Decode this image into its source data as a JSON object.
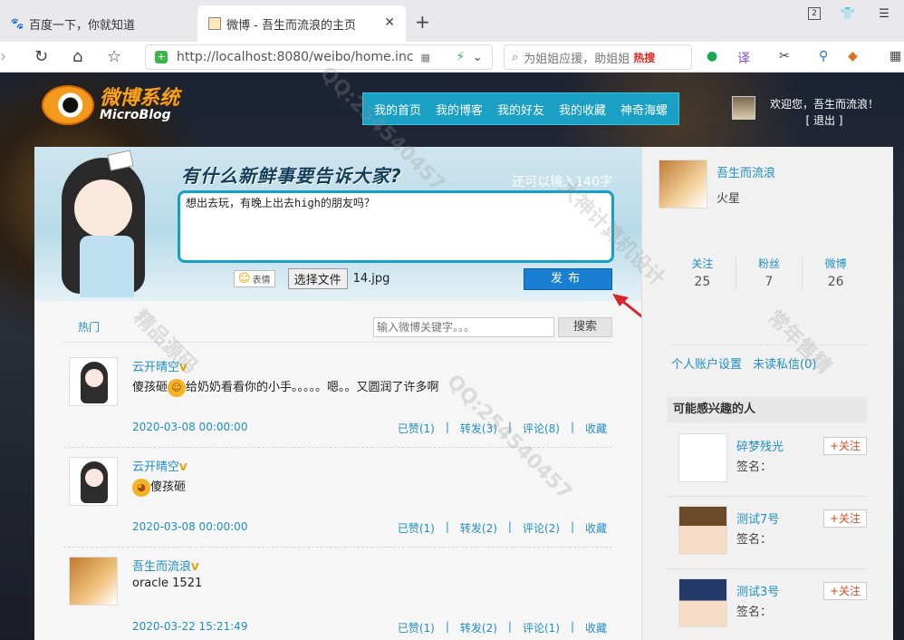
{
  "browser": {
    "tabs": [
      {
        "title": "百度一下，你就知道",
        "active": false
      },
      {
        "title": "微博 - 吾生而流浪的主页",
        "active": true
      }
    ],
    "url": "http://localhost:8080/weibo/home.inc",
    "search_placeholder": "为姐姐应援，助姐姐",
    "search_hot": "热搜",
    "tab_counter": "2"
  },
  "site": {
    "logo_cn": "微博系统",
    "logo_en": "MicroBlog",
    "nav": [
      "我的首页",
      "我的博客",
      "我的好友",
      "我的收藏",
      "神奇海螺"
    ],
    "welcome": "欢迎您，吾生而流浪！",
    "logout": "[ 退出 ]"
  },
  "publisher": {
    "slogan": "有什么新鲜事要告诉大家?",
    "counter": "还可以输入140字",
    "text": "想出去玩，有晚上出去high的朋友吗？",
    "emoji_label": "表情",
    "file_button": "选择文件",
    "file_name": "14.jpg",
    "publish_label": "发布"
  },
  "feed_search": {
    "hot_label": "热门",
    "placeholder": "输入微博关键字。。。",
    "button": "搜索"
  },
  "posts": [
    {
      "author": "云开晴空",
      "verified": "V",
      "text_before": "傻孩砸",
      "emoji": true,
      "text_after": "给奶奶看看你的小手。。。。。嗯。。又圆润了许多啊",
      "date": "2020-03-08 00:00:00",
      "like": "已赞(1)",
      "repost": "转发(3)",
      "comment": "评论(8)",
      "fav": "收藏"
    },
    {
      "author": "云开晴空",
      "verified": "V",
      "text_before": "",
      "emoji": true,
      "text_after": "傻孩砸",
      "date": "2020-03-08 00:00:00",
      "like": "已赞(1)",
      "repost": "转发(2)",
      "comment": "评论(2)",
      "fav": "收藏"
    },
    {
      "author": "吾生而流浪",
      "verified": "V",
      "text_before": "oracle 1521",
      "emoji": false,
      "text_after": "",
      "date": "2020-03-22 15:21:49",
      "like": "已赞(1)",
      "repost": "转发(2)",
      "comment": "评论(1)",
      "fav": "收藏"
    }
  ],
  "profile": {
    "name": "吾生而流浪",
    "location": "火星",
    "stats": [
      {
        "label": "关注",
        "value": "25"
      },
      {
        "label": "粉丝",
        "value": "7"
      },
      {
        "label": "微博",
        "value": "26"
      }
    ],
    "account_settings": "个人账户设置",
    "unread_messages": "未读私信(0)"
  },
  "suggestions": {
    "title": "可能感兴趣的人",
    "people": [
      {
        "name": "碎梦残光",
        "sign": "签名：",
        "follow": "+关注"
      },
      {
        "name": "测试7号",
        "sign": "签名：",
        "follow": "+关注"
      },
      {
        "name": "测试3号",
        "sign": "签名：",
        "follow": "+关注"
      }
    ]
  },
  "watermarks": [
    "QQ:254540457",
    "大神计算机设计",
    "精品源码",
    "常年售精"
  ],
  "colors": {
    "accent": "#1aa0c5",
    "link": "#1f8fc6",
    "publish": "#1a7fd2",
    "follow": "#e04a20"
  }
}
